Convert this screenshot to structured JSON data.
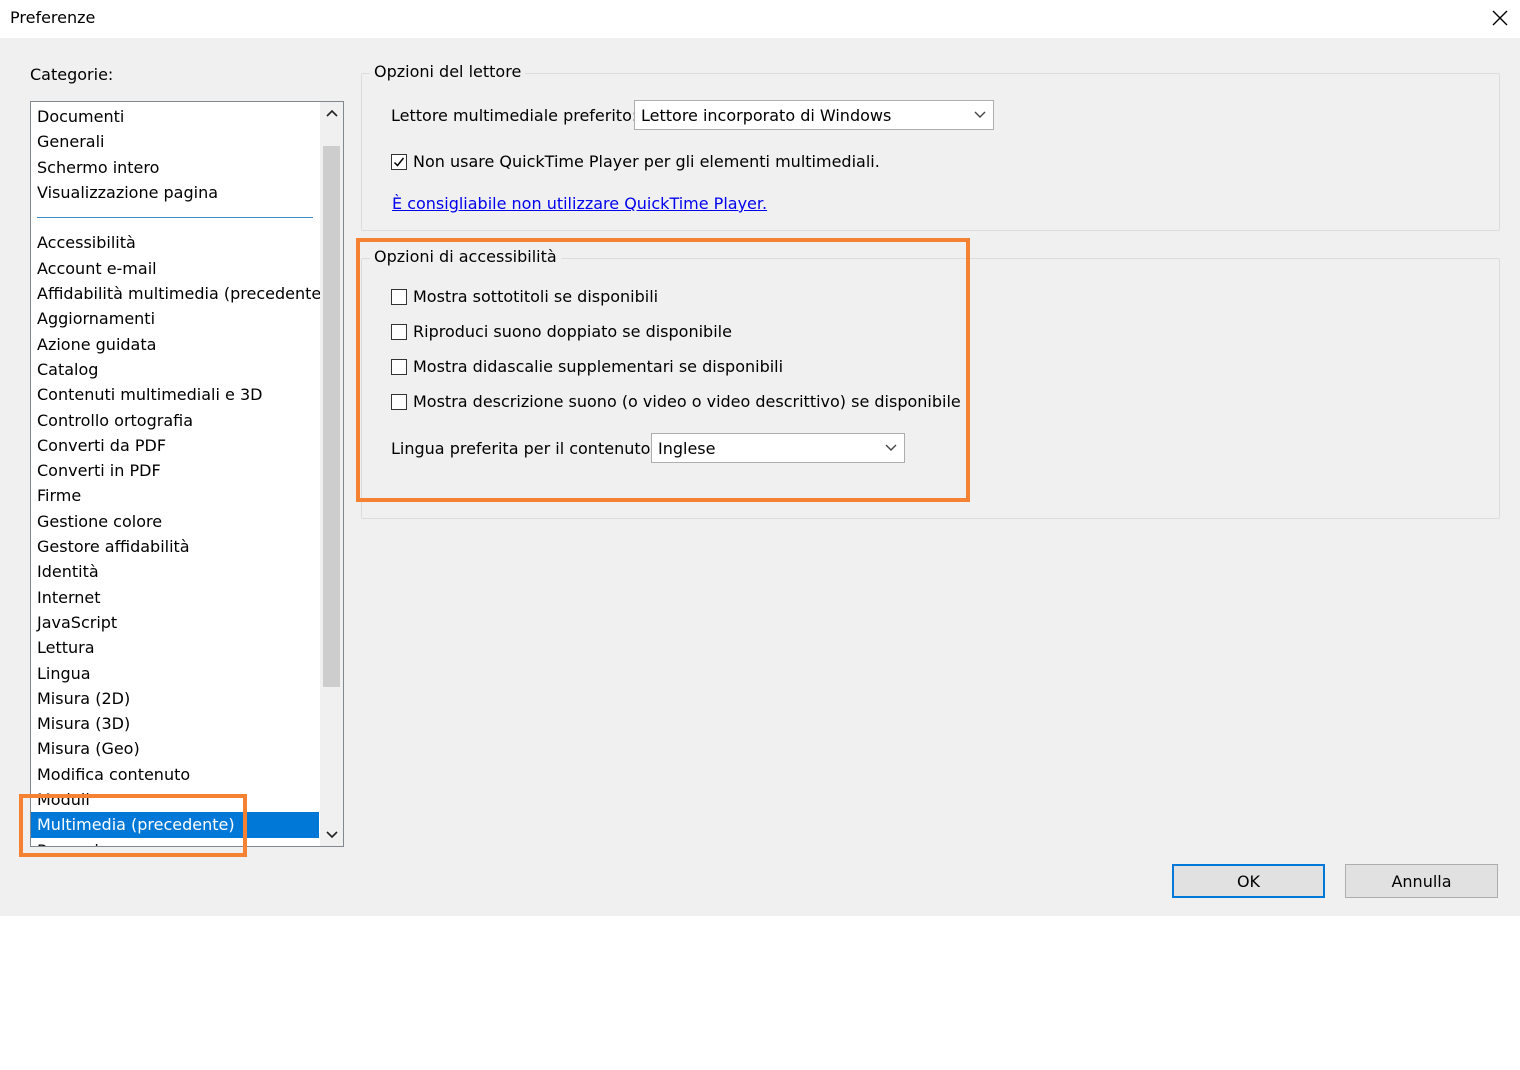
{
  "window": {
    "title": "Preferenze",
    "close_icon": "close-icon"
  },
  "categories": {
    "label": "Categorie:",
    "top_items": [
      "Documenti",
      "Generali",
      "Schermo intero",
      "Visualizzazione pagina"
    ],
    "items": [
      "Accessibilità",
      "Account e-mail",
      "Affidabilità multimedia (precedente)",
      "Aggiornamenti",
      "Azione guidata",
      "Catalog",
      "Contenuti multimediali e 3D",
      "Controllo ortografia",
      "Converti da PDF",
      "Converti in PDF",
      "Firme",
      "Gestione colore",
      "Gestore affidabilità",
      "Identità",
      "Internet",
      "JavaScript",
      "Lettura",
      "Lingua",
      "Misura (2D)",
      "Misura (3D)",
      "Misura (Geo)",
      "Modifica contenuto",
      "Moduli",
      "Multimedia (precedente)",
      "Recensione"
    ],
    "selected": "Multimedia (precedente)"
  },
  "player_options": {
    "title": "Opzioni del lettore",
    "preferred_player_label": "Lettore multimediale preferito:",
    "preferred_player_value": "Lettore incorporato di Windows",
    "no_quicktime_label": "Non usare QuickTime Player per gli elementi multimediali.",
    "no_quicktime_checked": true,
    "quicktime_link": "È consigliabile non utilizzare QuickTime Player."
  },
  "accessibility_options": {
    "title": "Opzioni di accessibilità",
    "checkboxes": [
      {
        "label": "Mostra sottotitoli se disponibili",
        "checked": false
      },
      {
        "label": "Riproduci suono doppiato se disponibile",
        "checked": false
      },
      {
        "label": "Mostra didascalie supplementari se disponibili",
        "checked": false
      },
      {
        "label": "Mostra descrizione suono (o video o video descrittivo) se disponibile",
        "checked": false
      }
    ],
    "language_label": "Lingua preferita per il contenuto:",
    "language_value": "Inglese"
  },
  "buttons": {
    "ok": "OK",
    "cancel": "Annulla"
  },
  "colors": {
    "selection": "#0078d7",
    "highlight": "#f58232",
    "link": "#0000ee",
    "dialog_bg": "#f0f0f0"
  }
}
